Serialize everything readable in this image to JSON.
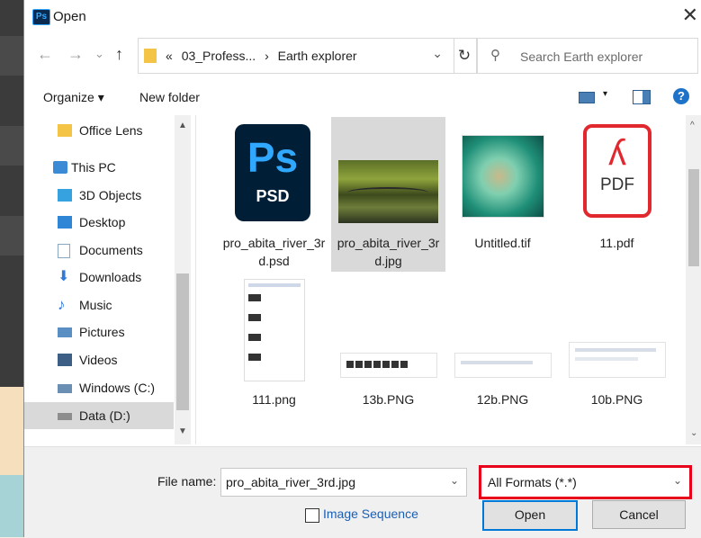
{
  "window": {
    "title": "Open",
    "app_icon": "Ps",
    "close": "✕"
  },
  "nav": {
    "back": "←",
    "forward": "→",
    "recent": "⌄",
    "up": "↑",
    "address_sep": "«",
    "address_part1": "03_Profess...",
    "address_arrow": "›",
    "address_part2": "Earth explorer",
    "dropdown": "⌄",
    "refresh": "↻",
    "search_icon": "⚲",
    "search_placeholder": "Search Earth explorer"
  },
  "toolbar": {
    "organize": "Organize ▾",
    "new_folder": "New folder",
    "view_caret": "▾",
    "help": "?"
  },
  "sidebar": {
    "items": [
      {
        "label": "Office Lens",
        "icon": "folder-icon",
        "color": "#f3c446"
      },
      {
        "label": "This PC",
        "icon": "computer-icon",
        "color": "#3a8ad6"
      },
      {
        "label": "3D Objects",
        "icon": "3d-objects-icon",
        "color": "#36a3e0"
      },
      {
        "label": "Desktop",
        "icon": "desktop-icon",
        "color": "#2f86d6"
      },
      {
        "label": "Documents",
        "icon": "documents-icon",
        "color": "#8aa6c1"
      },
      {
        "label": "Downloads",
        "icon": "downloads-icon",
        "color": "#2f7ad6"
      },
      {
        "label": "Music",
        "icon": "music-icon",
        "color": "#2f7ad6"
      },
      {
        "label": "Pictures",
        "icon": "pictures-icon",
        "color": "#5a8fc4"
      },
      {
        "label": "Videos",
        "icon": "videos-icon",
        "color": "#3d5f85"
      },
      {
        "label": "Windows (C:)",
        "icon": "drive-c-icon",
        "color": "#6b8fb3"
      },
      {
        "label": "Data (D:)",
        "icon": "drive-d-icon",
        "color": "#8d8d8d"
      }
    ]
  },
  "files": [
    {
      "name_line1": "pro_abita_river_3r",
      "name_line2": "d.psd",
      "type": "psd",
      "thumb_label": "Ps",
      "thumb_sub": "PSD"
    },
    {
      "name_line1": "pro_abita_river_3r",
      "name_line2": "d.jpg",
      "type": "photo",
      "selected": true
    },
    {
      "name_line1": "Untitled.tif",
      "name_line2": "",
      "type": "satellite"
    },
    {
      "name_line1": "11.pdf",
      "name_line2": "",
      "type": "pdf",
      "thumb_label": "PDF"
    },
    {
      "name_line1": "111.png",
      "name_line2": "",
      "type": "screenshot"
    },
    {
      "name_line1": "13b.PNG",
      "name_line2": "",
      "type": "strip"
    },
    {
      "name_line1": "12b.PNG",
      "name_line2": "",
      "type": "strip-light"
    },
    {
      "name_line1": "10b.PNG",
      "name_line2": "",
      "type": "strip-light"
    }
  ],
  "bottom": {
    "file_name_label": "File name:",
    "file_name_value": "pro_abita_river_3rd.jpg",
    "format_value": "All Formats (*.*)",
    "image_sequence": "Image Sequence",
    "open": "Open",
    "cancel": "Cancel",
    "dropdown": "⌄"
  },
  "colors": {
    "accent": "#0078d7",
    "highlight": "#e8001a",
    "selected_bg": "#d9d9d9"
  }
}
